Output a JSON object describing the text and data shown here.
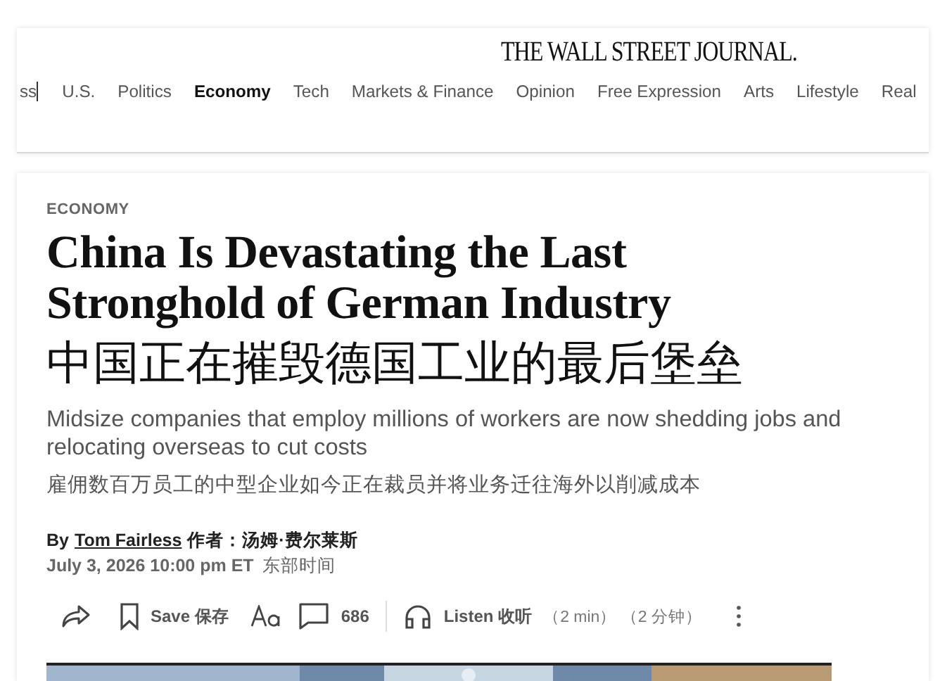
{
  "masthead": {
    "logo": "THE WALL STREET JOURNAL."
  },
  "nav": [
    {
      "label": "ss",
      "selected": false
    },
    {
      "label": "U.S.",
      "selected": false
    },
    {
      "label": "Politics",
      "selected": false
    },
    {
      "label": "Economy",
      "selected": true
    },
    {
      "label": "Tech",
      "selected": false
    },
    {
      "label": "Markets & Finance",
      "selected": false
    },
    {
      "label": "Opinion",
      "selected": false
    },
    {
      "label": "Free Expression",
      "selected": false
    },
    {
      "label": "Arts",
      "selected": false
    },
    {
      "label": "Lifestyle",
      "selected": false
    },
    {
      "label": "Real",
      "selected": false
    }
  ],
  "article": {
    "section": "ECONOMY",
    "headline": "China Is Devastating the Last Stronghold of German Industry",
    "headline_zh": "中国正在摧毁德国工业的最后堡垒",
    "dek": "Midsize companies that employ millions of workers are now shedding jobs and relocating overseas to cut costs",
    "dek_zh": "雇佣数百万员工的中型企业如今正在裁员并将业务迁往海外以削减成本",
    "byline_prefix": "By",
    "author": "Tom Fairless",
    "author_zh": "作者：汤姆·费尔莱斯",
    "date": "July 3, 2026 10:00 pm ET",
    "date_zh": "东部时间"
  },
  "toolbar": [
    {
      "kind": "share"
    },
    {
      "kind": "save",
      "label": "Save",
      "label_zh": "保存"
    },
    {
      "kind": "text-size"
    },
    {
      "kind": "comments",
      "count": "686"
    },
    {
      "kind": "listen",
      "label": "Listen",
      "label_zh": "收听",
      "duration": "（2 min）",
      "duration_zh": "（2 分钟）"
    },
    {
      "kind": "more"
    }
  ]
}
